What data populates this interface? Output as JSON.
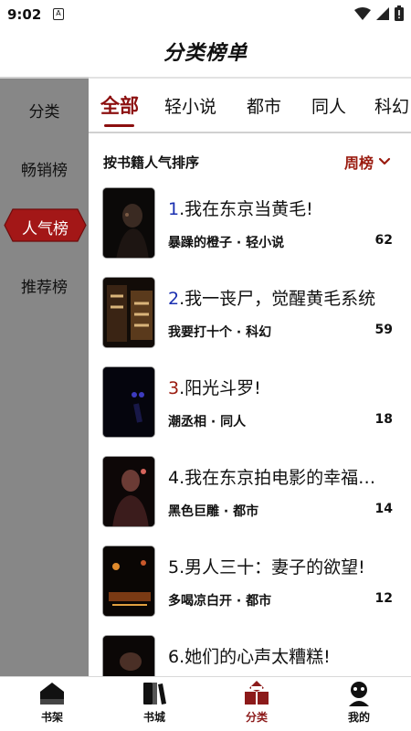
{
  "status_bar": {
    "time": "9:02",
    "app_icon": "A"
  },
  "header": {
    "title": "分类榜单"
  },
  "sidebar": {
    "items": [
      {
        "label": "分类"
      },
      {
        "label": "畅销榜"
      },
      {
        "label": "人气榜"
      },
      {
        "label": "推荐榜"
      }
    ],
    "active_index": 2
  },
  "tabs": [
    {
      "label": "全部"
    },
    {
      "label": "轻小说"
    },
    {
      "label": "都市"
    },
    {
      "label": "同人"
    },
    {
      "label": "科幻"
    }
  ],
  "sort": {
    "label": "按书籍人气排序",
    "period": "周榜"
  },
  "books": [
    {
      "rank": "1",
      "title": "我在东京当黄毛!",
      "author_genre": "暴躁的橙子 · 轻小说",
      "count": "62"
    },
    {
      "rank": "2",
      "title": "我一丧尸，觉醒黄毛系统",
      "author_genre": "我要打十个 · 科幻",
      "count": "59"
    },
    {
      "rank": "3",
      "title": "阳光斗罗!",
      "author_genre": "潮丞相 · 同人",
      "count": "18"
    },
    {
      "rank": "4",
      "title": "我在东京拍电影的幸福生活",
      "author_genre": "黑色巨雕 · 都市",
      "count": "14"
    },
    {
      "rank": "5",
      "title": "男人三十：妻子的欲望!",
      "author_genre": "多喝凉白开 · 都市",
      "count": "12"
    },
    {
      "rank": "6",
      "title": "她们的心声太糟糕!",
      "author_genre": "",
      "count": ""
    }
  ],
  "bottom_nav": [
    {
      "label": "书架",
      "icon": "bookshelf-icon"
    },
    {
      "label": "书城",
      "icon": "bookstore-icon"
    },
    {
      "label": "分类",
      "icon": "category-icon"
    },
    {
      "label": "我的",
      "icon": "profile-icon"
    }
  ],
  "colors": {
    "accent": "#8c0f0f",
    "rank_1": "#1a2fb0",
    "rank_2": "#1a2fb0",
    "rank_3": "#9a1b0f",
    "sidebar_bg": "#878787"
  }
}
